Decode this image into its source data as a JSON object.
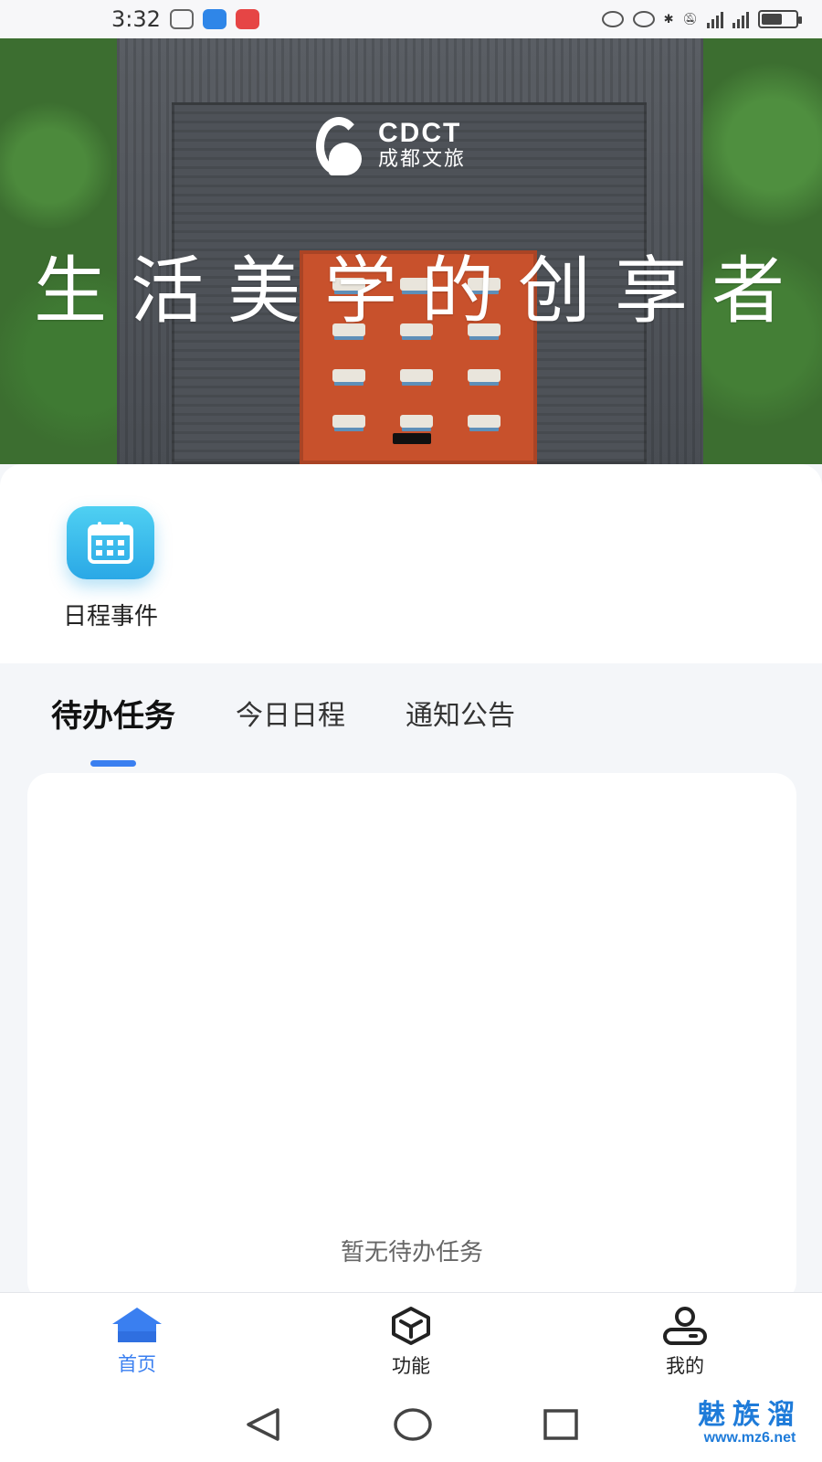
{
  "status_bar": {
    "time": "3:32"
  },
  "hero": {
    "logo_name": "CDCT",
    "logo_sub": "成都文旅",
    "slogan": "生活美学的创享者"
  },
  "quick_apps": [
    {
      "label": "日程事件",
      "icon": "calendar-icon"
    }
  ],
  "tabs": [
    {
      "label": "待办任务",
      "active": true
    },
    {
      "label": "今日日程",
      "active": false
    },
    {
      "label": "通知公告",
      "active": false
    }
  ],
  "content": {
    "empty_text": "暂无待办任务"
  },
  "bottom_nav": [
    {
      "label": "首页",
      "icon": "home-icon",
      "active": true
    },
    {
      "label": "功能",
      "icon": "cube-icon",
      "active": false
    },
    {
      "label": "我的",
      "icon": "user-icon",
      "active": false
    }
  ],
  "watermark": {
    "line1": "魅族溜",
    "line2": "www.mz6.net"
  },
  "colors": {
    "accent": "#3a7ff0",
    "calendar_bg": "#2aa8e6"
  }
}
